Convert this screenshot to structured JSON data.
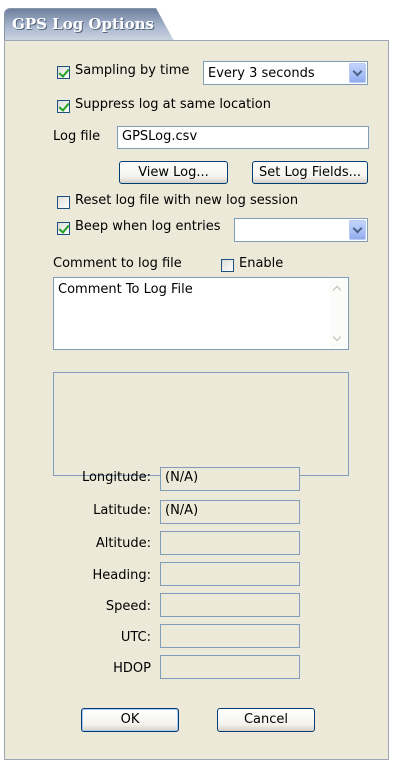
{
  "window": {
    "title": "GPS Log Options"
  },
  "sampling": {
    "label": "Sampling by time",
    "checked": true,
    "interval_value": "Every 3 seconds"
  },
  "suppress": {
    "label": "Suppress log at same location",
    "checked": true
  },
  "log_file": {
    "label": "Log file",
    "value": "GPSLog.csv"
  },
  "buttons": {
    "view_log": "View Log...",
    "set_log_fields": "Set Log Fields...",
    "ok": "OK",
    "cancel": "Cancel"
  },
  "reset": {
    "label": "Reset log file with new log session",
    "checked": false
  },
  "beep": {
    "label": "Beep when log entries",
    "checked": true,
    "value": ""
  },
  "comment": {
    "label": "Comment to log file",
    "enable_label": "Enable",
    "enable_checked": false,
    "text": "Comment To Log File"
  },
  "readouts": {
    "longitude": {
      "label": "Longitude:",
      "value": "(N/A)"
    },
    "latitude": {
      "label": "Latitude:",
      "value": "(N/A)"
    },
    "altitude": {
      "label": "Altitude:",
      "value": ""
    },
    "heading": {
      "label": "Heading:",
      "value": ""
    },
    "speed": {
      "label": "Speed:",
      "value": ""
    },
    "utc": {
      "label": "UTC:",
      "value": ""
    },
    "hdop": {
      "label": "HDOP",
      "value": ""
    }
  },
  "colors": {
    "panel_bg": "#ece9d8",
    "field_border": "#7f9db9",
    "check_green": "#21a121",
    "combo_blue": "#a8c0f7"
  }
}
